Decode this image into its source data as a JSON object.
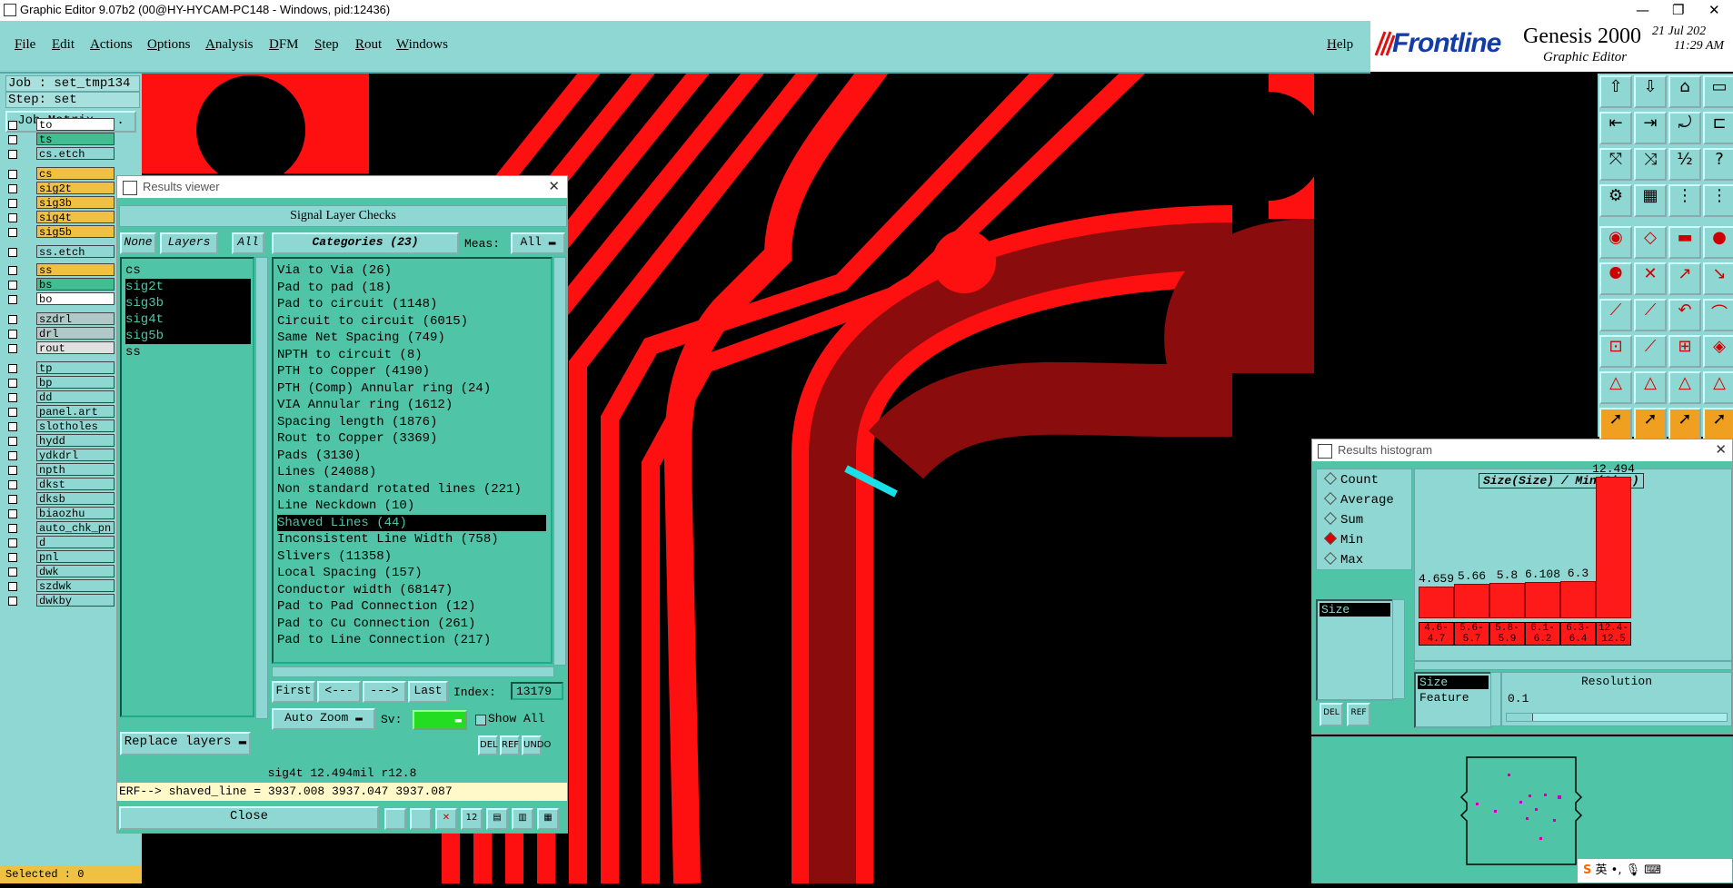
{
  "window": {
    "title": "Graphic Editor 9.07b2 (00@HY-HYCAM-PC148 - Windows, pid:12436)"
  },
  "menu": {
    "items": [
      "File",
      "Edit",
      "Actions",
      "Options",
      "Analysis",
      "DFM",
      "Step",
      "Rout",
      "Windows"
    ],
    "help": "Help"
  },
  "brand": {
    "logo": "Frontline",
    "product": "Genesis 2000",
    "subtitle": "Graphic Editor",
    "date": "21 Jul 202",
    "time": "11:29 AM"
  },
  "left": {
    "job": "Job : set_tmp134",
    "step": "Step: set",
    "job_matrix": "Job Matrix ...",
    "layers": [
      {
        "name": "to",
        "color": "#ffffff"
      },
      {
        "name": "ts",
        "color": "#3fbf8f"
      },
      {
        "name": "cs.etch",
        "color": "#8fd7d3"
      },
      {
        "name": "cs",
        "color": "#f0c040"
      },
      {
        "name": "sig2t",
        "color": "#f0c040"
      },
      {
        "name": "sig3b",
        "color": "#f0c040"
      },
      {
        "name": "sig4t",
        "color": "#f0c040"
      },
      {
        "name": "sig5b",
        "color": "#f0c040"
      },
      {
        "name": "ss.etch",
        "color": "#8fd7d3"
      },
      {
        "name": "ss",
        "color": "#f0c040"
      },
      {
        "name": "bs",
        "color": "#3fbf8f"
      },
      {
        "name": "bo",
        "color": "#ffffff"
      },
      {
        "name": "szdrl",
        "color": "#b0c8c8"
      },
      {
        "name": "drl",
        "color": "#b0c8c8"
      },
      {
        "name": "rout",
        "color": "#e0e0e0"
      },
      {
        "name": "tp",
        "color": "#8fd7d3"
      },
      {
        "name": "bp",
        "color": "#8fd7d3"
      },
      {
        "name": "dd",
        "color": "#8fd7d3"
      },
      {
        "name": "panel.art",
        "color": "#8fd7d3"
      },
      {
        "name": "slotholes",
        "color": "#8fd7d3"
      },
      {
        "name": "hydd",
        "color": "#8fd7d3"
      },
      {
        "name": "ydkdrl",
        "color": "#8fd7d3"
      },
      {
        "name": "npth",
        "color": "#8fd7d3"
      },
      {
        "name": "dkst",
        "color": "#8fd7d3"
      },
      {
        "name": "dksb",
        "color": "#8fd7d3"
      },
      {
        "name": "biaozhu",
        "color": "#8fd7d3"
      },
      {
        "name": "auto_chk_pn",
        "color": "#8fd7d3"
      },
      {
        "name": "d",
        "color": "#8fd7d3"
      },
      {
        "name": "pnl",
        "color": "#8fd7d3"
      },
      {
        "name": "dwk",
        "color": "#8fd7d3"
      },
      {
        "name": "szdwk",
        "color": "#8fd7d3"
      },
      {
        "name": "dwkby",
        "color": "#8fd7d3"
      }
    ],
    "selected": "Selected : 0"
  },
  "results_viewer": {
    "title": "Results viewer",
    "header": "Signal Layer Checks",
    "none": "None",
    "layers_btn": "Layers",
    "all": "All",
    "categories_label": "Categories (23)",
    "meas_label": "Meas:",
    "meas_value": "All",
    "layers": [
      "cs",
      "sig2t",
      "sig3b",
      "sig4t",
      "sig5b",
      "ss"
    ],
    "categories": [
      "Via to Via (26)",
      "Pad to pad (18)",
      "Pad to circuit (1148)",
      "Circuit to circuit (6015)",
      "Same Net Spacing (749)",
      "NPTH to circuit (8)",
      "PTH to Copper (4190)",
      "PTH (Comp) Annular ring (24)",
      "VIA Annular ring (1612)",
      "Spacing length (1876)",
      "Rout to Copper (3369)",
      "Pads (3130)",
      "Lines (24088)",
      "Non standard rotated lines (221)",
      "Line Neckdown (10)",
      "Shaved Lines (44)",
      "Inconsistent Line Width (758)",
      "Slivers (11358)",
      "Local Spacing (157)",
      "Conductor width (68147)",
      "Pad to Pad Connection (12)",
      "Pad to Cu Connection (261)",
      "Pad to Line Connection (217)"
    ],
    "selected_category": "Shaved Lines (44)",
    "first": "First",
    "prev": "<---",
    "next": "--->",
    "last": "Last",
    "index_label": "Index:",
    "index_value": "13179",
    "auto_zoom": "Auto Zoom",
    "sv_label": "Sv:",
    "show_all": "Show All",
    "replace_layers": "Replace layers",
    "del": "DEL",
    "ref": "REF",
    "undo": "UNDO",
    "info": "sig4t 12.494mil  r12.8",
    "erf": "ERF--> shaved_line = 3937.008 3937.047 3937.087",
    "close": "Close"
  },
  "histogram": {
    "title": "Results histogram",
    "options": [
      "Count",
      "Average",
      "Sum",
      "Min",
      "Max"
    ],
    "selected_option": "Min",
    "field": "Size",
    "chart_title": "Size(Size) / Min(Size)",
    "bins": [
      {
        "value": 4.659,
        "label": "4.659",
        "range": "4.6- 4.7"
      },
      {
        "value": 5.66,
        "label": "5.66",
        "range": "5.6- 5.7"
      },
      {
        "value": 5.8,
        "label": "5.8",
        "range": "5.8- 5.9"
      },
      {
        "value": 6.108,
        "label": "6.108",
        "range": "6.1- 6.2"
      },
      {
        "value": 6.3,
        "label": "6.3",
        "range": "6.3- 6.4"
      },
      {
        "value": 12.494,
        "label": "12.494",
        "range": "12.4- 12.5"
      }
    ],
    "size_label": "Size",
    "feature_label": "Feature",
    "resolution_label": "Resolution",
    "resolution_value": "0.1",
    "del": "DEL",
    "ref": "REF"
  },
  "tray": {
    "ime": "英"
  }
}
